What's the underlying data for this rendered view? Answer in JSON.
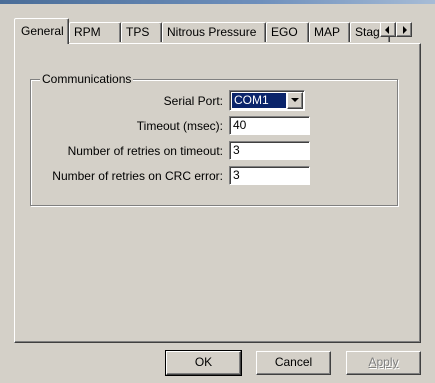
{
  "tabs": [
    {
      "label": "General",
      "selected": true
    },
    {
      "label": "RPM"
    },
    {
      "label": "TPS"
    },
    {
      "label": "Nitrous Pressure"
    },
    {
      "label": "EGO"
    },
    {
      "label": "MAP"
    },
    {
      "label": "Stag"
    }
  ],
  "tab_scroll": {
    "left_icon": "arrow-left-icon",
    "right_icon": "arrow-right-icon"
  },
  "communications": {
    "title": "Communications",
    "serial_port": {
      "label": "Serial Port:",
      "value": "COM1"
    },
    "timeout": {
      "label": "Timeout (msec):",
      "value": "40"
    },
    "retries_timeout": {
      "label": "Number of retries on timeout:",
      "value": "3"
    },
    "retries_crc": {
      "label": "Number of retries on CRC error:",
      "value": "3"
    }
  },
  "buttons": {
    "ok": "OK",
    "cancel": "Cancel",
    "apply": "Apply"
  },
  "colors": {
    "face": "#d4d0c8",
    "selection": "#0a246a"
  }
}
